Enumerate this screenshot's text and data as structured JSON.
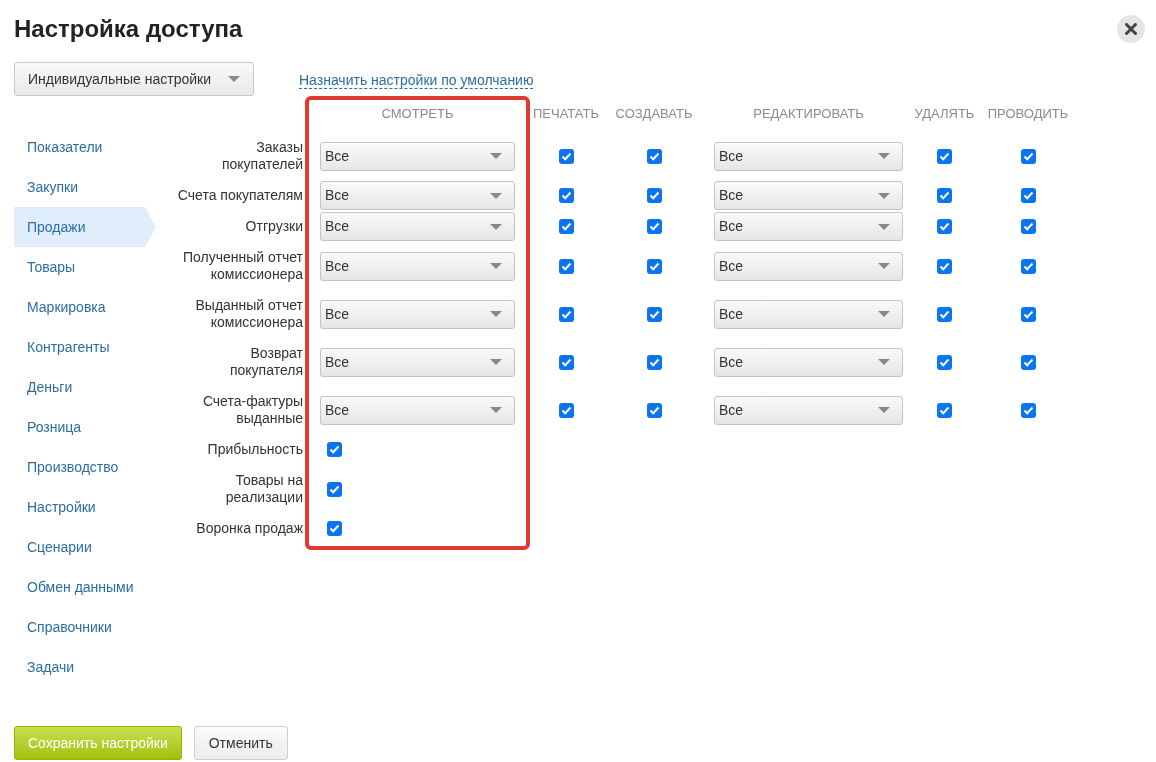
{
  "window": {
    "title": "Настройка доступа"
  },
  "mode_dropdown": {
    "value": "Индивидуальные настройки"
  },
  "default_link": "Назначить настройки по умолчанию",
  "sidebar": {
    "items": [
      {
        "label": "Показатели",
        "selected": false
      },
      {
        "label": "Закупки",
        "selected": false
      },
      {
        "label": "Продажи",
        "selected": true
      },
      {
        "label": "Товары",
        "selected": false
      },
      {
        "label": "Маркировка",
        "selected": false
      },
      {
        "label": "Контрагенты",
        "selected": false
      },
      {
        "label": "Деньги",
        "selected": false
      },
      {
        "label": "Розница",
        "selected": false
      },
      {
        "label": "Производство",
        "selected": false
      },
      {
        "label": "Настройки",
        "selected": false
      },
      {
        "label": "Сценарии",
        "selected": false
      },
      {
        "label": "Обмен данными",
        "selected": false
      },
      {
        "label": "Справочники",
        "selected": false
      },
      {
        "label": "Задачи",
        "selected": false
      }
    ]
  },
  "table": {
    "columns": [
      {
        "label": "СМОТРЕТЬ",
        "highlighted": true
      },
      {
        "label": "ПЕЧАТАТЬ",
        "highlighted": false
      },
      {
        "label": "СОЗДАВАТЬ",
        "highlighted": false
      },
      {
        "label": "РЕДАКТИРОВАТЬ",
        "highlighted": false
      },
      {
        "label": "УДАЛЯТЬ",
        "highlighted": false
      },
      {
        "label": "ПРОВОДИТЬ",
        "highlighted": false
      }
    ],
    "rows": [
      {
        "label": "Заказы покупателей",
        "cells": [
          {
            "kind": "select",
            "value": "Все"
          },
          {
            "kind": "checkbox",
            "checked": true
          },
          {
            "kind": "checkbox",
            "checked": true
          },
          {
            "kind": "select",
            "value": "Все"
          },
          {
            "kind": "checkbox",
            "checked": true
          },
          {
            "kind": "checkbox",
            "checked": true
          }
        ]
      },
      {
        "label": "Счета покупателям",
        "cells": [
          {
            "kind": "select",
            "value": "Все"
          },
          {
            "kind": "checkbox",
            "checked": true
          },
          {
            "kind": "checkbox",
            "checked": true
          },
          {
            "kind": "select",
            "value": "Все"
          },
          {
            "kind": "checkbox",
            "checked": true
          },
          {
            "kind": "checkbox",
            "checked": true
          }
        ]
      },
      {
        "label": "Отгрузки",
        "cells": [
          {
            "kind": "select",
            "value": "Все"
          },
          {
            "kind": "checkbox",
            "checked": true
          },
          {
            "kind": "checkbox",
            "checked": true
          },
          {
            "kind": "select",
            "value": "Все"
          },
          {
            "kind": "checkbox",
            "checked": true
          },
          {
            "kind": "checkbox",
            "checked": true
          }
        ]
      },
      {
        "label": "Полученный отчет комиссионера",
        "cells": [
          {
            "kind": "select",
            "value": "Все"
          },
          {
            "kind": "checkbox",
            "checked": true
          },
          {
            "kind": "checkbox",
            "checked": true
          },
          {
            "kind": "select",
            "value": "Все"
          },
          {
            "kind": "checkbox",
            "checked": true
          },
          {
            "kind": "checkbox",
            "checked": true
          }
        ]
      },
      {
        "label": "Выданный отчет комиссионера",
        "cells": [
          {
            "kind": "select",
            "value": "Все"
          },
          {
            "kind": "checkbox",
            "checked": true
          },
          {
            "kind": "checkbox",
            "checked": true
          },
          {
            "kind": "select",
            "value": "Все"
          },
          {
            "kind": "checkbox",
            "checked": true
          },
          {
            "kind": "checkbox",
            "checked": true
          }
        ]
      },
      {
        "label": "Возврат покупателя",
        "cells": [
          {
            "kind": "select",
            "value": "Все"
          },
          {
            "kind": "checkbox",
            "checked": true
          },
          {
            "kind": "checkbox",
            "checked": true
          },
          {
            "kind": "select",
            "value": "Все"
          },
          {
            "kind": "checkbox",
            "checked": true
          },
          {
            "kind": "checkbox",
            "checked": true
          }
        ]
      },
      {
        "label": "Счета-фактуры выданные",
        "cells": [
          {
            "kind": "select",
            "value": "Все"
          },
          {
            "kind": "checkbox",
            "checked": true
          },
          {
            "kind": "checkbox",
            "checked": true
          },
          {
            "kind": "select",
            "value": "Все"
          },
          {
            "kind": "checkbox",
            "checked": true
          },
          {
            "kind": "checkbox",
            "checked": true
          }
        ]
      },
      {
        "label": "Прибыльность",
        "cells": [
          {
            "kind": "checkbox",
            "checked": true
          }
        ]
      },
      {
        "label": "Товары на реализации",
        "cells": [
          {
            "kind": "checkbox",
            "checked": true
          }
        ]
      },
      {
        "label": "Воронка продаж",
        "cells": [
          {
            "kind": "checkbox",
            "checked": true
          }
        ]
      }
    ]
  },
  "buttons": [
    {
      "label": "Сохранить настройки",
      "kind": "primary"
    },
    {
      "label": "Отменить",
      "kind": "secondary"
    }
  ]
}
